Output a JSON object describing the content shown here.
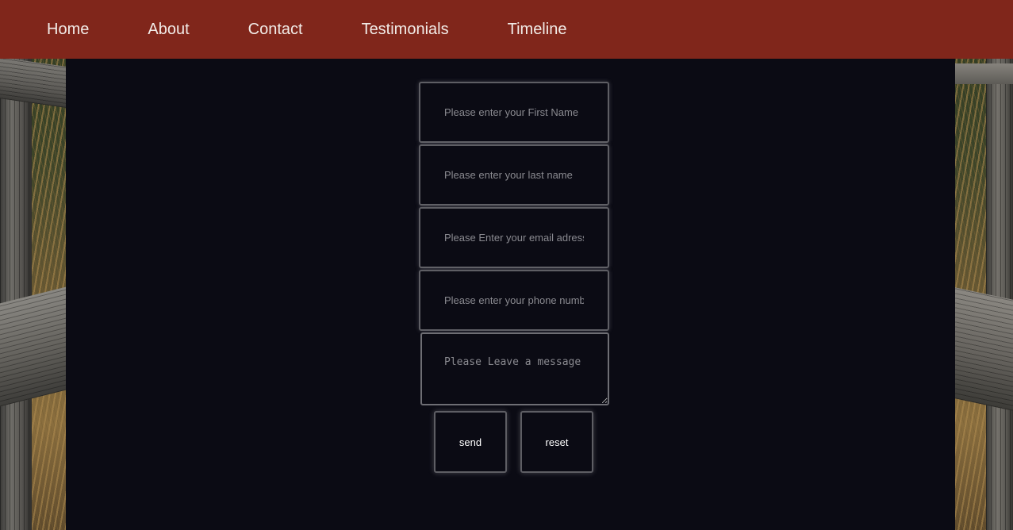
{
  "nav": {
    "items": [
      {
        "label": "Home"
      },
      {
        "label": "About"
      },
      {
        "label": "Contact"
      },
      {
        "label": "Testimonials"
      },
      {
        "label": "Timeline"
      }
    ]
  },
  "form": {
    "first_name_placeholder": "Please enter your First Name",
    "last_name_placeholder": "Please enter your last name",
    "email_placeholder": "Please Enter your email adress",
    "phone_placeholder": "Please enter your phone number",
    "message_placeholder": "Please Leave a message",
    "send_label": "send",
    "reset_label": "reset"
  },
  "colors": {
    "navbar": "#80261b",
    "panel": "#0b0b14"
  }
}
